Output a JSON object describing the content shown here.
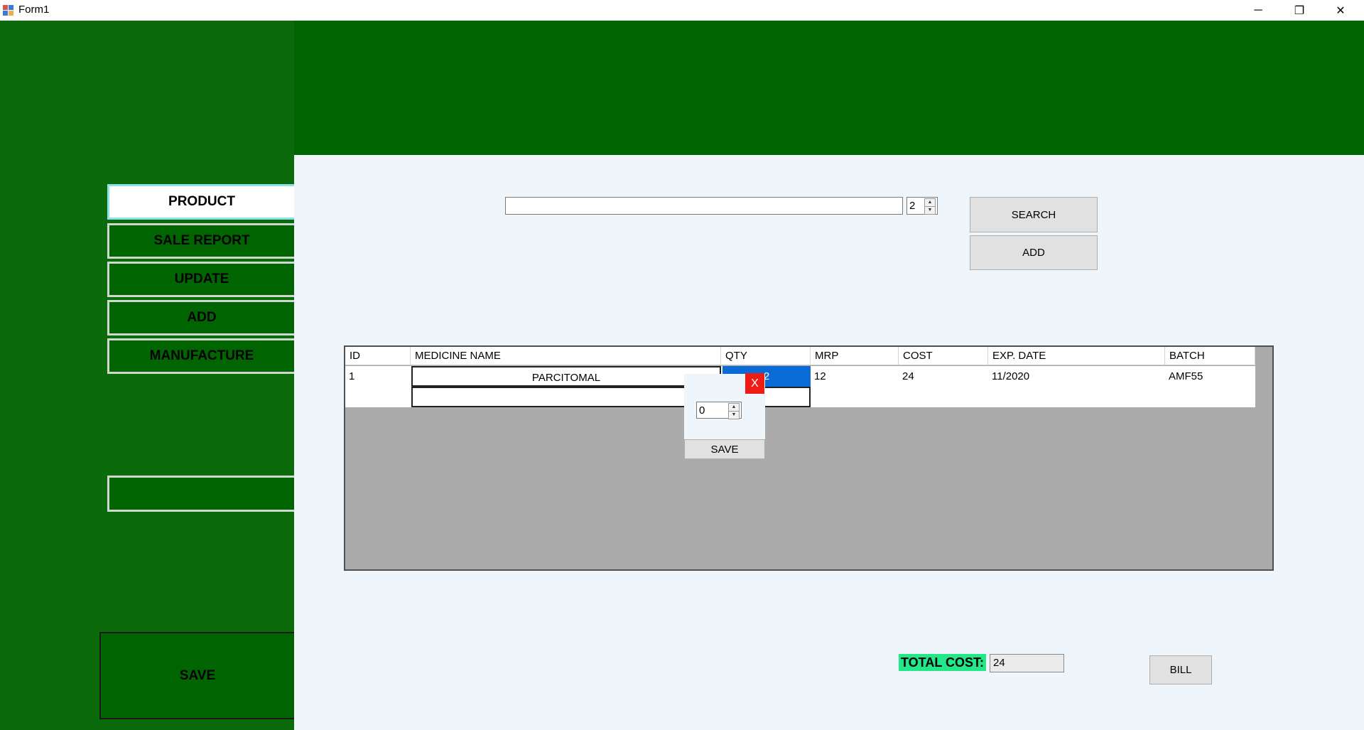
{
  "window": {
    "title": "Form1",
    "minimize": "─",
    "maximize": "❐",
    "close": "✕"
  },
  "sidebar": {
    "items": [
      {
        "label": "PRODUCT"
      },
      {
        "label": "SALE REPORT"
      },
      {
        "label": "UPDATE"
      },
      {
        "label": "ADD"
      },
      {
        "label": "MANUFACTURE"
      }
    ],
    "save_label": "SAVE"
  },
  "search": {
    "value": "",
    "quantity": "2",
    "search_label": "SEARCH",
    "add_label": "ADD"
  },
  "grid": {
    "columns": [
      "ID",
      "MEDICINE NAME",
      "QTY",
      "MRP",
      "COST",
      "EXP. DATE",
      "BATCH"
    ],
    "rows": [
      {
        "id": "1",
        "name": "PARCITOMAL",
        "qty": "2",
        "mrp": "12",
        "cost": "24",
        "exp": "11/2020",
        "batch": "AMF55"
      }
    ]
  },
  "popup": {
    "close_label": "X",
    "quantity": "0",
    "save_label": "SAVE"
  },
  "totals": {
    "label": "TOTAL COST:",
    "value": "24",
    "bill_label": "BILL"
  },
  "colors": {
    "green": "#006400",
    "content_bg": "#eef6fc",
    "selection": "#0a6bd6",
    "total_highlight": "#22e88a",
    "close_red": "#ee1c14"
  }
}
